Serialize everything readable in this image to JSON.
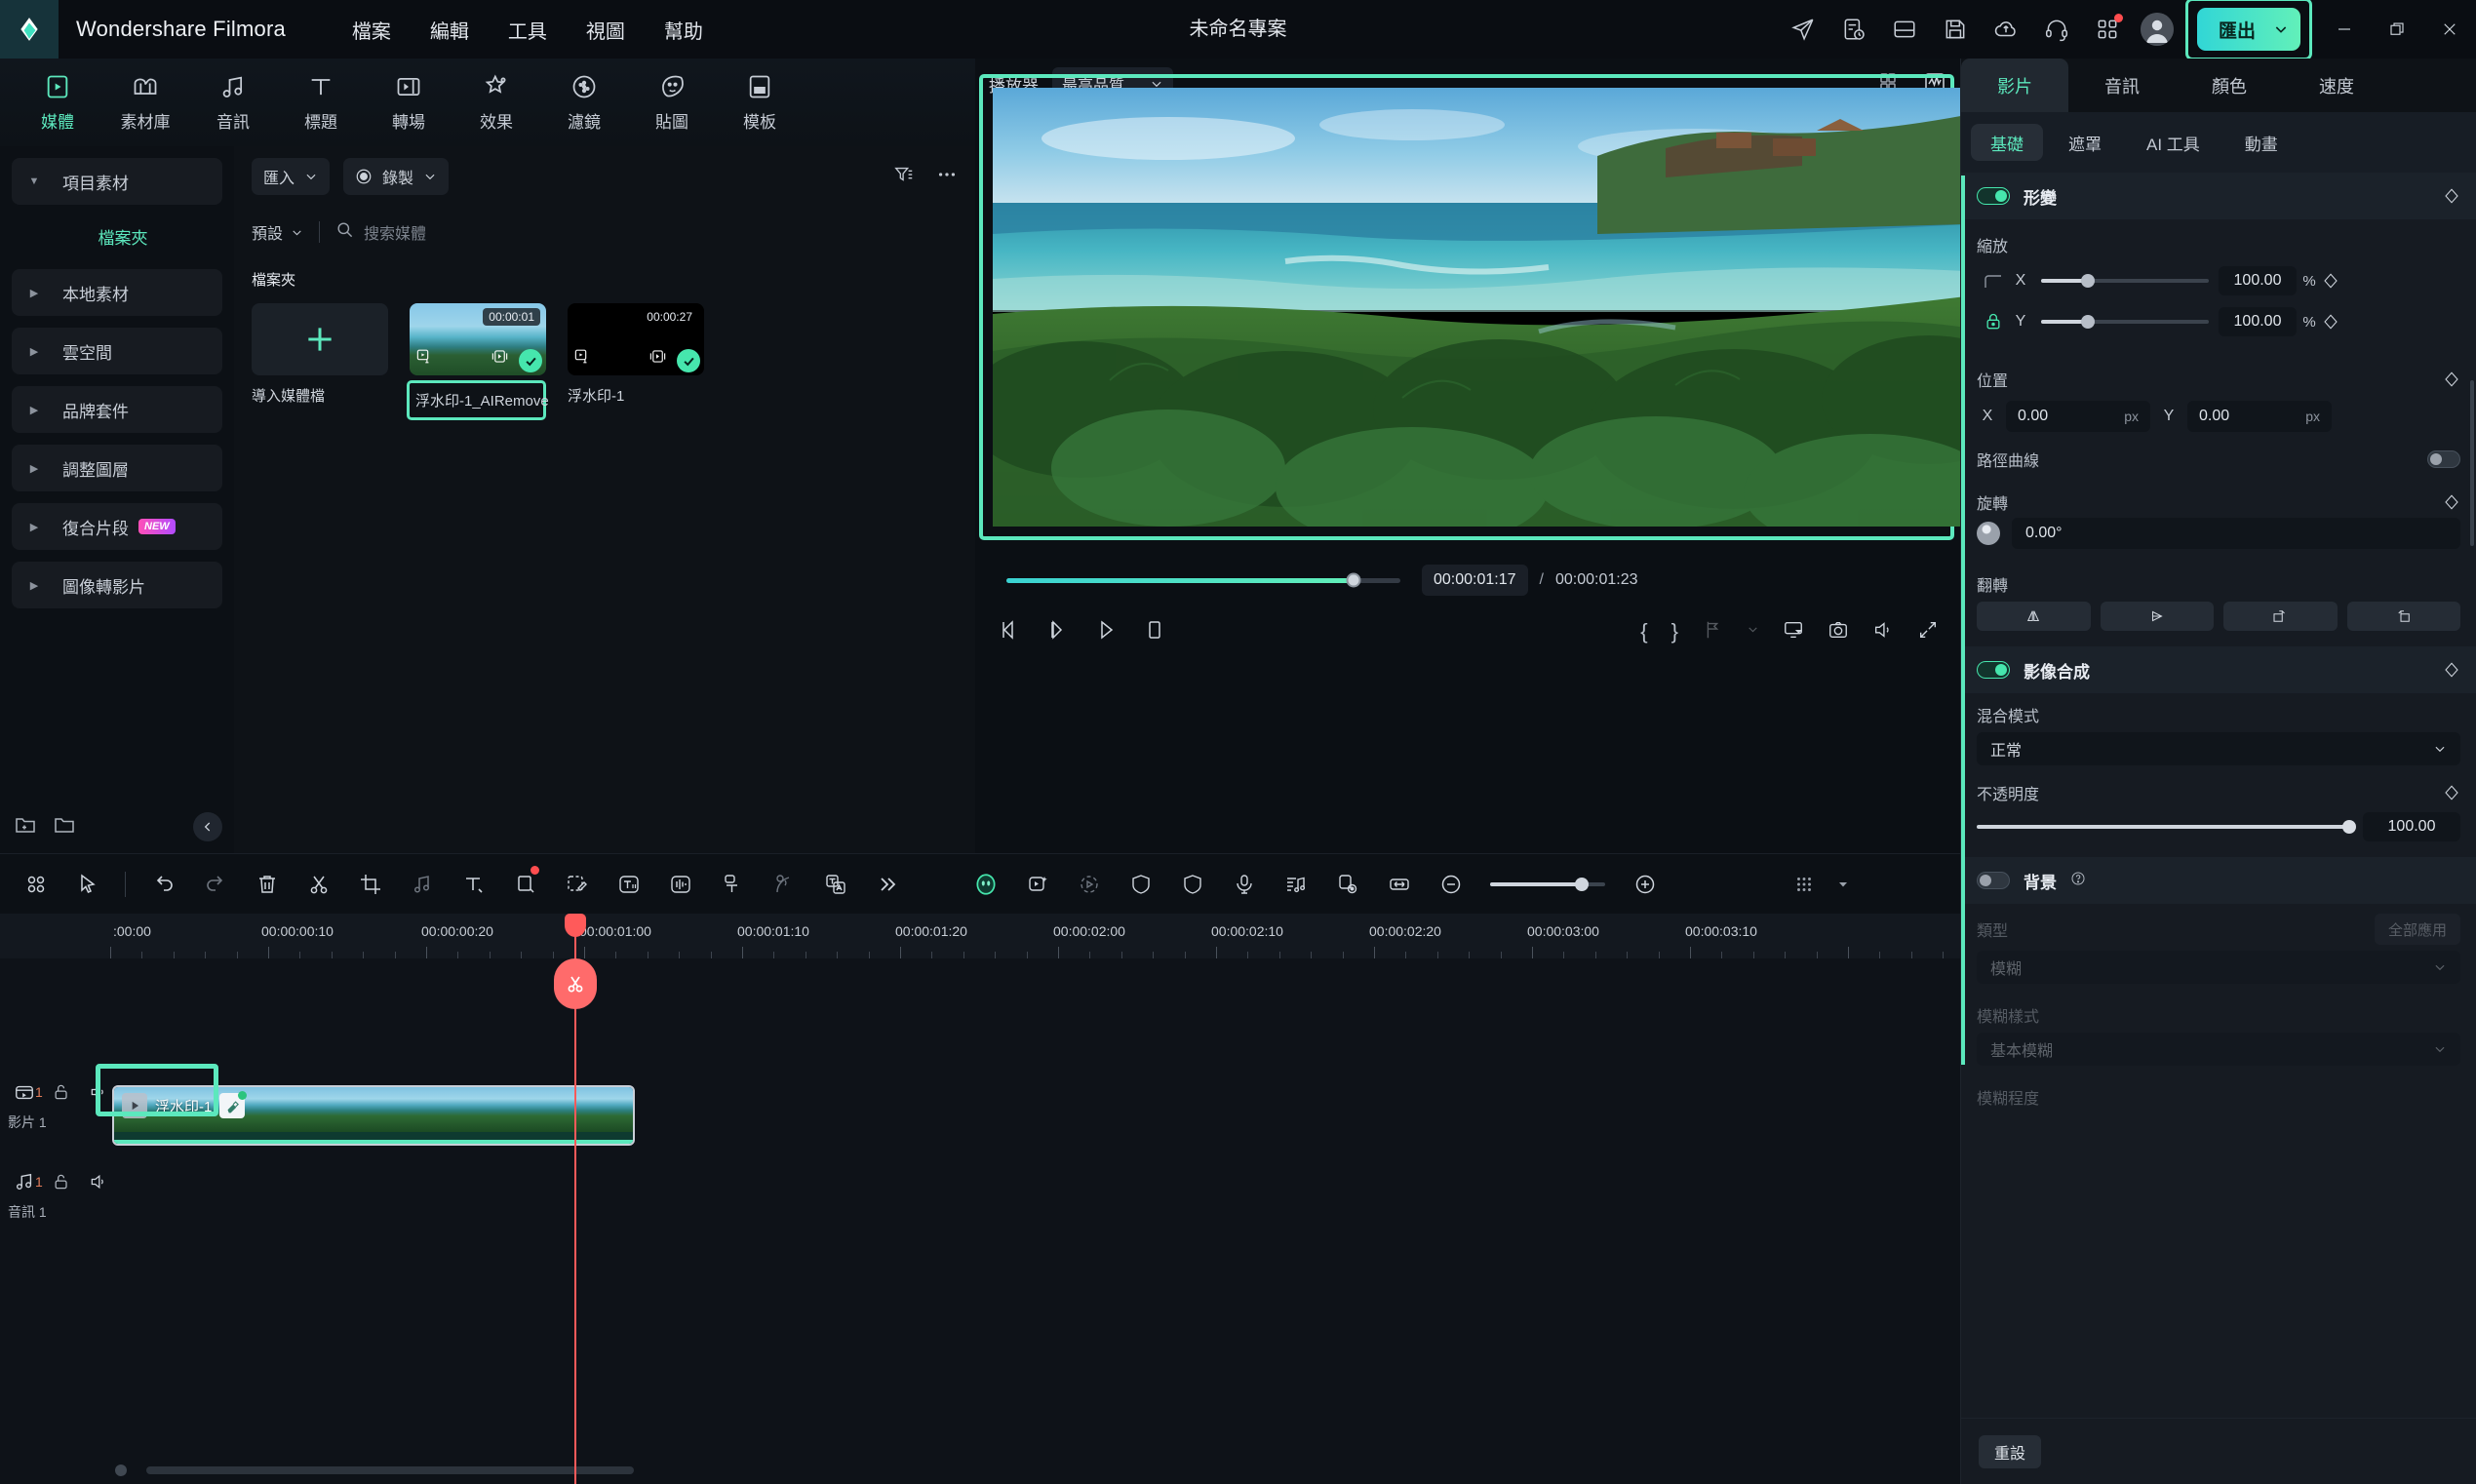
{
  "titlebar": {
    "brand": "Wondershare Filmora",
    "project_title": "未命名專案",
    "menus": [
      {
        "label": "檔案"
      },
      {
        "label": "編輯"
      },
      {
        "label": "工具"
      },
      {
        "label": "視圖"
      },
      {
        "label": "幫助"
      }
    ],
    "icons": [
      {
        "name": "send-icon"
      },
      {
        "name": "task-history-icon"
      },
      {
        "name": "layout-icon"
      },
      {
        "name": "save-icon"
      },
      {
        "name": "cloud-upload-icon"
      },
      {
        "name": "headset-support-icon"
      },
      {
        "name": "apps-grid-icon",
        "badge": true
      }
    ],
    "export_label": "匯出",
    "window_controls": {
      "minimize": "minimize-icon",
      "restore": "restore-icon",
      "close": "close-icon"
    }
  },
  "topnav": {
    "items": [
      {
        "label": "媒體",
        "icon": "media-icon",
        "active": true
      },
      {
        "label": "素材庫",
        "icon": "stock-library-icon",
        "active": false
      },
      {
        "label": "音訊",
        "icon": "audio-icon",
        "active": false
      },
      {
        "label": "標題",
        "icon": "title-icon",
        "active": false
      },
      {
        "label": "轉場",
        "icon": "transition-icon",
        "active": false
      },
      {
        "label": "效果",
        "icon": "effects-icon",
        "active": false
      },
      {
        "label": "濾鏡",
        "icon": "filter-icon",
        "active": false
      },
      {
        "label": "貼圖",
        "icon": "sticker-icon",
        "active": false
      },
      {
        "label": "模板",
        "icon": "template-icon",
        "active": false
      }
    ]
  },
  "sidebar": {
    "items": [
      {
        "label": "項目素材",
        "caret": "down",
        "kind": "group",
        "active": false
      },
      {
        "label": "檔案夾",
        "kind": "folder",
        "active": true
      },
      {
        "label": "本地素材",
        "caret": "right",
        "kind": "group",
        "active": false
      },
      {
        "label": "雲空間",
        "caret": "right",
        "kind": "group",
        "active": false
      },
      {
        "label": "品牌套件",
        "caret": "right",
        "kind": "group",
        "active": false
      },
      {
        "label": "調整圖層",
        "caret": "right",
        "kind": "group",
        "active": false
      },
      {
        "label": "復合片段",
        "caret": "right",
        "kind": "group",
        "active": false,
        "badge": "NEW"
      },
      {
        "label": "圖像轉影片",
        "caret": "right",
        "kind": "group",
        "active": false
      }
    ],
    "bottom_icons": [
      {
        "name": "new-folder-icon"
      },
      {
        "name": "open-folder-icon"
      }
    ],
    "collapse_icon": "chevron-left-icon"
  },
  "media_panel": {
    "import_label": "匯入",
    "record_label": "錄製",
    "filter_icon": "filter-sort-icon",
    "more_icon": "more-horizontal-icon",
    "sort_label": "預設",
    "search_placeholder": "搜索媒體",
    "search_icon": "search-icon",
    "folder_label": "檔案夾",
    "items": [
      {
        "name": "導入媒體檔",
        "kind": "add",
        "duration": "",
        "selected": false,
        "highlighted": false
      },
      {
        "name": "浮水印-1_AIRemove",
        "kind": "video",
        "duration": "00:00:01",
        "selected": true,
        "highlighted": true
      },
      {
        "name": "浮水印-1",
        "kind": "video",
        "duration": "00:00:27",
        "selected": true,
        "highlighted": false
      }
    ]
  },
  "player": {
    "label": "播放器",
    "quality": "最高品質",
    "header_icons": [
      {
        "name": "split-view-icon"
      },
      {
        "name": "scope-waveform-icon"
      }
    ],
    "current_time": "00:00:01:17",
    "separator": "/",
    "total_time": "00:00:01:23",
    "progress_percent": 88,
    "transport": [
      {
        "name": "previous-frame-icon"
      },
      {
        "name": "next-frame-icon"
      },
      {
        "name": "play-icon"
      },
      {
        "name": "stop-icon"
      }
    ],
    "right_icons": [
      {
        "name": "mark-in-brace"
      },
      {
        "name": "mark-out-brace"
      },
      {
        "name": "marker-icon"
      },
      {
        "name": "chevron-down-icon"
      },
      {
        "name": "render-preview-icon"
      },
      {
        "name": "snapshot-icon"
      },
      {
        "name": "volume-icon"
      },
      {
        "name": "fullscreen-icon"
      }
    ]
  },
  "right_panel": {
    "tabs": [
      {
        "label": "影片",
        "active": true
      },
      {
        "label": "音訊",
        "active": false
      },
      {
        "label": "顏色",
        "active": false
      },
      {
        "label": "速度",
        "active": false
      }
    ],
    "subtabs": [
      {
        "label": "基礎",
        "active": true
      },
      {
        "label": "遮罩",
        "active": false
      },
      {
        "label": "AI 工具",
        "active": false
      },
      {
        "label": "動畫",
        "active": false
      }
    ],
    "transform": {
      "title": "形變",
      "enabled": true,
      "scale_label": "縮放",
      "scale_x_axis": "X",
      "scale_x_value": "100.00",
      "scale_x_unit": "%",
      "scale_y_axis": "Y",
      "scale_y_value": "100.00",
      "scale_y_unit": "%",
      "lock_icon": "lock-icon",
      "position_label": "位置",
      "pos_x_axis": "X",
      "pos_x_value": "0.00",
      "pos_x_unit": "px",
      "pos_y_axis": "Y",
      "pos_y_value": "0.00",
      "pos_y_unit": "px",
      "path_curve_label": "路徑曲線",
      "path_curve_enabled": false,
      "rotate_label": "旋轉",
      "rotate_value": "0.00°",
      "flip_label": "翻轉",
      "flip_buttons": [
        {
          "name": "flip-horizontal-icon"
        },
        {
          "name": "flip-vertical-icon"
        },
        {
          "name": "rotate-cw-icon"
        },
        {
          "name": "rotate-ccw-icon"
        }
      ]
    },
    "compositing": {
      "title": "影像合成",
      "enabled": true,
      "blend_label": "混合模式",
      "blend_value": "正常",
      "opacity_label": "不透明度",
      "opacity_value": "100.00",
      "opacity_percent": 100
    },
    "background": {
      "title": "背景",
      "enabled": false,
      "help_icon": "help-icon",
      "type_label": "類型",
      "apply_all_label": "全部應用",
      "type_value": "模糊",
      "blur_style_label": "模糊樣式",
      "blur_style_value": "基本模糊",
      "blur_amount_label": "模糊程度"
    },
    "reset_label": "重設"
  },
  "timeline": {
    "toolbar_icons": [
      {
        "name": "panels-grid-icon"
      },
      {
        "name": "select-tool-icon"
      },
      {
        "name": "separator"
      },
      {
        "name": "undo-icon"
      },
      {
        "name": "redo-icon"
      },
      {
        "name": "delete-icon"
      },
      {
        "name": "split-scissors-icon"
      },
      {
        "name": "crop-icon"
      },
      {
        "name": "audio-detach-icon"
      },
      {
        "name": "text-tool-icon"
      },
      {
        "name": "shape-tool-icon",
        "badge": true
      },
      {
        "name": "mask-tool-icon"
      },
      {
        "name": "text-ai-icon"
      },
      {
        "name": "audio-waveform-icon"
      },
      {
        "name": "speech-to-text-icon"
      },
      {
        "name": "voice-detect-icon"
      },
      {
        "name": "translate-icon"
      },
      {
        "name": "more-chevrons-icon"
      },
      {
        "name": "ai-avatar-icon",
        "active": true
      },
      {
        "name": "smart-cutout-icon"
      },
      {
        "name": "motion-tracking-icon"
      },
      {
        "name": "stabilize-icon"
      },
      {
        "name": "shield-icon"
      },
      {
        "name": "voiceover-mic-icon"
      },
      {
        "name": "audio-mixer-icon"
      },
      {
        "name": "auto-sync-icon"
      },
      {
        "name": "fit-timeline-icon"
      },
      {
        "name": "zoom-out-icon"
      },
      {
        "name": "zoom-in-icon"
      },
      {
        "name": "timeline-settings-icon"
      },
      {
        "name": "chevron-down-icon"
      }
    ],
    "zoom_percent": 80,
    "ruler_labels": [
      ":00:00",
      "00:00:00:10",
      "00:00:00:20",
      "00:00:01:00",
      "00:00:01:10",
      "00:00:01:20",
      "00:00:02:00",
      "00:00:02:10",
      "00:00:02:20",
      "00:00:03:00",
      "00:00:03:10"
    ],
    "tracks": [
      {
        "name": "影片 1",
        "number": "1",
        "type_icon": "video-track-icon",
        "lock_icon": "unlock-icon",
        "mute_icon": "volume-icon",
        "eye_icon": "eye-icon"
      },
      {
        "name": "音訊 1",
        "number": "1",
        "type_icon": "audio-track-icon",
        "lock_icon": "unlock-icon",
        "mute_icon": "volume-icon"
      }
    ],
    "clip": {
      "title": "浮水印-1",
      "play_icon": "play-icon",
      "ai_icon": "ai-remove-icon",
      "selected": true
    },
    "playhead_marker_icon": "scissors-icon"
  }
}
